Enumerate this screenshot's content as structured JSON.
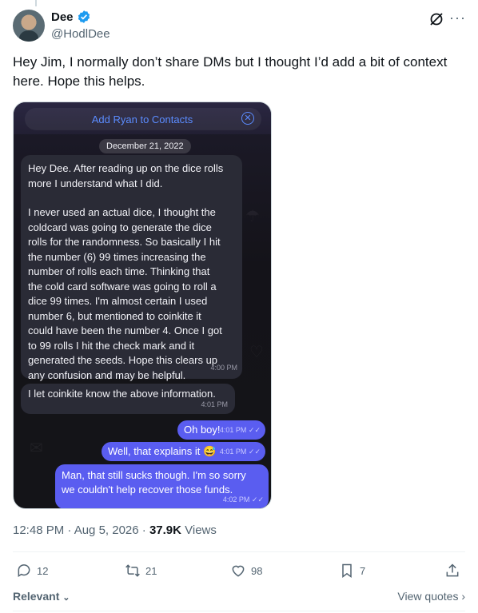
{
  "author": {
    "name": "Dee",
    "handle": "@HodlDee"
  },
  "tweet": {
    "text": "Hey Jim, I normally don’t share DMs but I thought I’d add a bit of context here. Hope this helps."
  },
  "screenshot": {
    "add_contact": "Add Ryan to Contacts",
    "date_chip": "December 21, 2022",
    "incoming": [
      {
        "lines": [
          "Hey Dee. After reading up on the dice rolls",
          "more I understand what I did.",
          "",
          "I never used an actual dice, I thought the",
          "coldcard was going to generate the dice",
          "rolls for the randomness. So basically I hit",
          "the number (6) 99 times increasing the",
          "number of rolls each time. Thinking that",
          "the cold card software was going to roll a",
          "dice 99 times. I'm almost certain I used",
          "number 6, but mentioned to coinkite it",
          "could have been the number 4. Once I got",
          "to 99 rolls I hit the check mark and it",
          "generated the seeds. Hope this clears up",
          "any confusion and may be helpful."
        ],
        "time": "4:00 PM"
      },
      {
        "text": "I let coinkite know the above information.",
        "time": "4:01 PM"
      }
    ],
    "outgoing": [
      {
        "text": "Oh boy!",
        "time": "4:01 PM"
      },
      {
        "text": "Well, that explains it 😅",
        "time": "4:01 PM"
      },
      {
        "text": "Man, that still sucks though. I'm so sorry we couldn't help recover those funds.",
        "time": "4:02 PM"
      }
    ]
  },
  "meta": {
    "time_date": "12:48 PM · Aug 5, 2026 · ",
    "views_count": "37.9K",
    "views_label": " Views"
  },
  "actions": {
    "replies": "12",
    "reposts": "21",
    "likes": "98",
    "bookmarks": "7"
  },
  "footer": {
    "sort_label": "Relevant",
    "view_quotes": "View quotes"
  },
  "colors": {
    "accent": "#1d9bf0",
    "outgoing_bubble": "#5a5df0",
    "incoming_bubble": "#2a2b36"
  }
}
